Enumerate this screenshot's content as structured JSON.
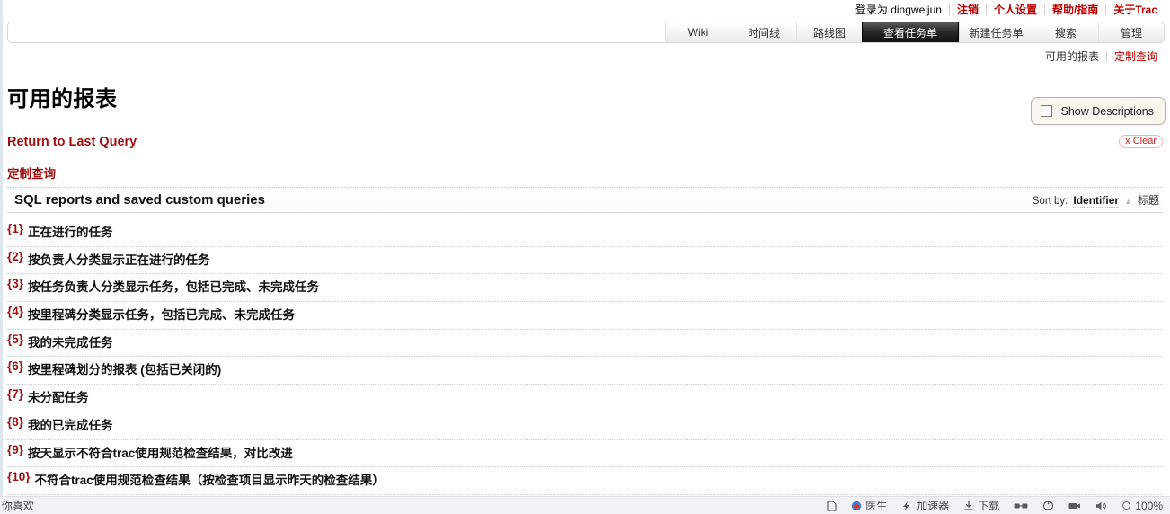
{
  "metanav": {
    "logged_in_prefix": "登录为",
    "username": "dingweijun",
    "links": [
      {
        "label": "注销"
      },
      {
        "label": "个人设置"
      },
      {
        "label": "帮助/指南"
      },
      {
        "label": "关于Trac"
      }
    ]
  },
  "mainnav": {
    "tabs": [
      {
        "label": "Wiki",
        "active": false
      },
      {
        "label": "时间线",
        "active": false
      },
      {
        "label": "路线图",
        "active": false
      },
      {
        "label": "查看任务单",
        "active": true
      },
      {
        "label": "新建任务单",
        "active": false
      },
      {
        "label": "搜索",
        "active": false
      },
      {
        "label": "管理",
        "active": false
      }
    ]
  },
  "ctxnav": {
    "current": "可用的报表",
    "link": "定制查询"
  },
  "page": {
    "title": "可用的报表"
  },
  "descriptions_toggle": {
    "label": "Show Descriptions",
    "checked": false
  },
  "last_query": {
    "label": "Return to Last Query"
  },
  "clear": {
    "label": "x Clear"
  },
  "custom_query": {
    "label": "定制查询"
  },
  "reports_section": {
    "heading": "SQL reports and saved custom queries",
    "sort": {
      "prefix": "Sort by:",
      "current": "Identifier",
      "arrow": "▲",
      "other": "标题"
    }
  },
  "reports": [
    {
      "id": "{1}",
      "title": "正在进行的任务"
    },
    {
      "id": "{2}",
      "title": "按负责人分类显示正在进行的任务"
    },
    {
      "id": "{3}",
      "title": "按任务负责人分类显示任务，包括已完成、未完成任务"
    },
    {
      "id": "{4}",
      "title": "按里程碑分类显示任务，包括已完成、未完成任务"
    },
    {
      "id": "{5}",
      "title": "我的未完成任务"
    },
    {
      "id": "{6}",
      "title": "按里程碑划分的报表 (包括已关闭的)"
    },
    {
      "id": "{7}",
      "title": "未分配任务"
    },
    {
      "id": "{8}",
      "title": "我的已完成任务"
    },
    {
      "id": "{9}",
      "title": "按天显示不符合trac使用规范检查结果，对比改进"
    },
    {
      "id": "{10}",
      "title": "不符合trac使用规范检查结果（按检查项目显示昨天的检查结果）"
    }
  ],
  "statusbar": {
    "left_text": "你喜欢",
    "items": [
      {
        "label": "",
        "icon": "page-icon"
      },
      {
        "label": "医生",
        "icon": "doctor-icon"
      },
      {
        "label": "加速器",
        "icon": "accelerator-icon"
      },
      {
        "label": "下载",
        "icon": "download-icon"
      },
      {
        "label": "",
        "icon": "glasses-icon"
      },
      {
        "label": "",
        "icon": "mouse-gesture-icon"
      },
      {
        "label": "",
        "icon": "video-icon"
      },
      {
        "label": "",
        "icon": "speaker-icon"
      }
    ],
    "zoom": "100%"
  },
  "colors": {
    "link_red": "#bb0000",
    "heading_red": "#9b1111",
    "active_tab_bg": "#111111"
  }
}
